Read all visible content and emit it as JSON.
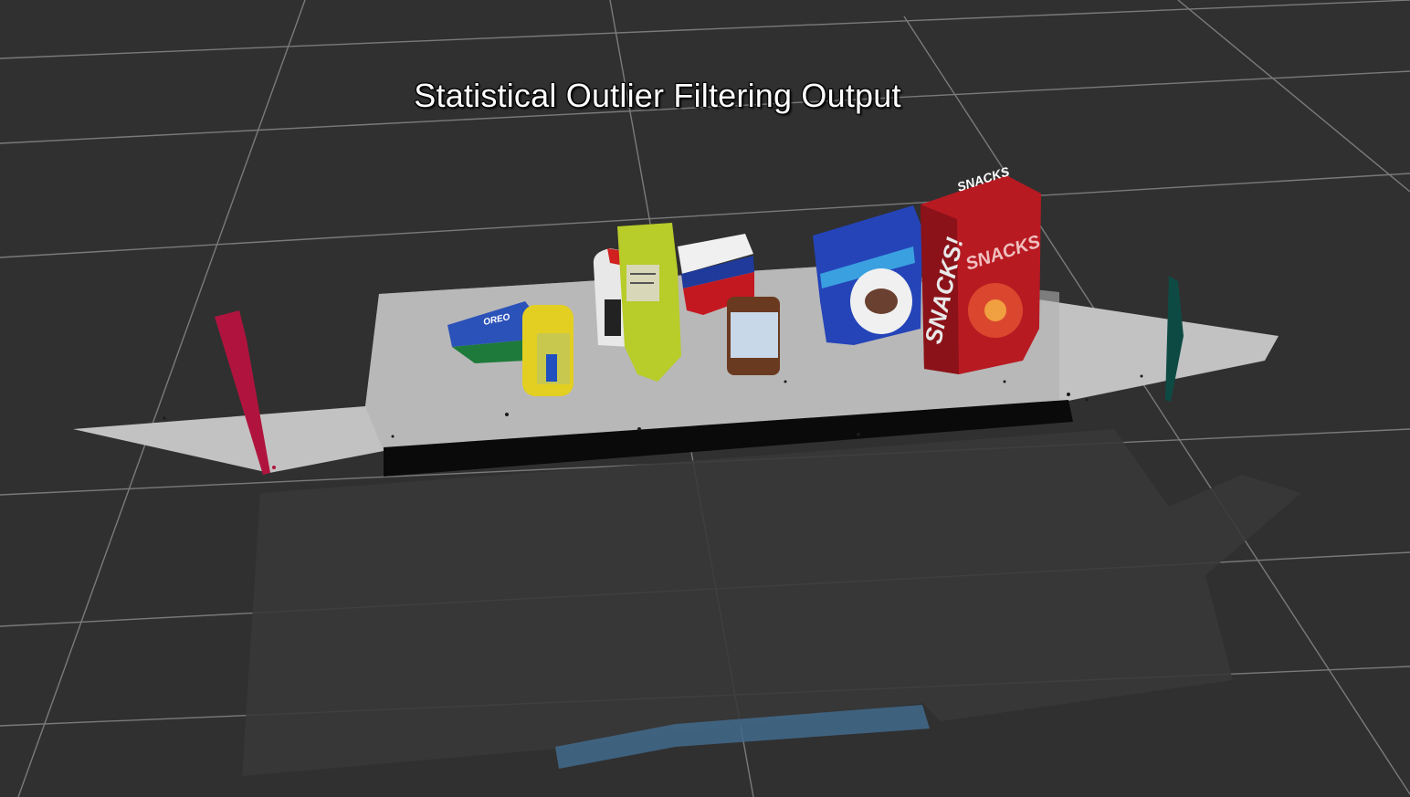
{
  "overlay": {
    "title": "Statistical Outlier Filtering Output"
  },
  "scene": {
    "background_color": "#303030",
    "grid_color": "#a0a0a0",
    "table_color": "#c6c6c6",
    "floor_shadow_color": "#383838",
    "box_labels": {
      "snacks_primary": "SNACKS",
      "snacks_side": "SNACKS!"
    },
    "objects": [
      {
        "name": "biscuits",
        "color": "#2850b0"
      },
      {
        "name": "soap",
        "color": "#e0d020"
      },
      {
        "name": "glue",
        "color": "#e8e8e8"
      },
      {
        "name": "book",
        "color": "#b8cc30"
      },
      {
        "name": "soap2",
        "color": "#d03040"
      },
      {
        "name": "eraser",
        "color": "#e0e0f0"
      },
      {
        "name": "sticky-notes",
        "color": "#2040b0"
      },
      {
        "name": "snacks",
        "color": "#b01820"
      }
    ]
  }
}
